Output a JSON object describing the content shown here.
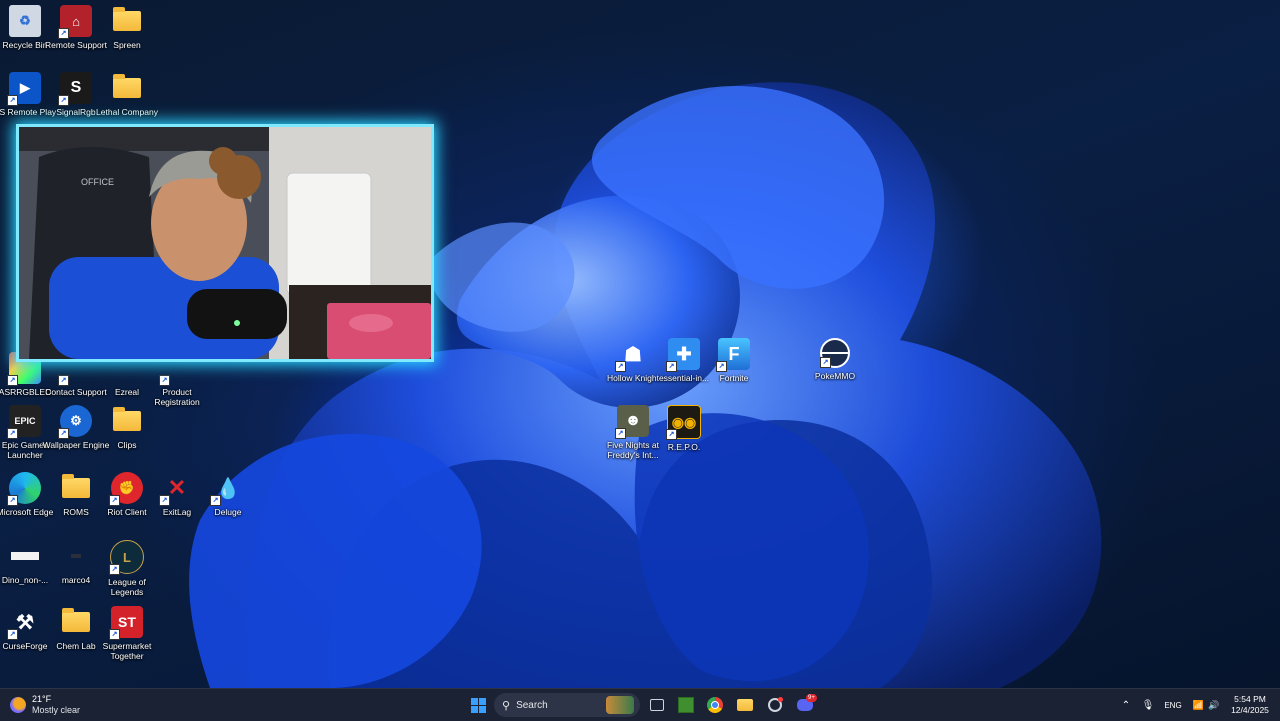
{
  "desktop_icons": [
    {
      "id": "recycle-bin",
      "label": "Recycle Bin"
    },
    {
      "id": "remote-support",
      "label": "Remote Support"
    },
    {
      "id": "spreen",
      "label": "Spreen"
    },
    {
      "id": "ps-remote-play",
      "label": "PS Remote Play"
    },
    {
      "id": "signalrgb",
      "label": "SignalRgb"
    },
    {
      "id": "lethal-company",
      "label": "Lethal Company"
    },
    {
      "id": "asrrgbled",
      "label": "ASRRGBLED"
    },
    {
      "id": "contact-support",
      "label": "Contact Support"
    },
    {
      "id": "ezreal",
      "label": "Ezreal"
    },
    {
      "id": "product-registration",
      "label": "Product Registration"
    },
    {
      "id": "epic-games-launcher",
      "label": "Epic Games Launcher"
    },
    {
      "id": "wallpaper-engine",
      "label": "Wallpaper Engine"
    },
    {
      "id": "clips",
      "label": "Clips"
    },
    {
      "id": "microsoft-edge",
      "label": "Microsoft Edge"
    },
    {
      "id": "roms",
      "label": "ROMS"
    },
    {
      "id": "riot-client",
      "label": "Riot Client"
    },
    {
      "id": "exitlag",
      "label": "ExitLag"
    },
    {
      "id": "deluge",
      "label": "Deluge"
    },
    {
      "id": "dino",
      "label": "Dino_non-..."
    },
    {
      "id": "marco4",
      "label": "marco4"
    },
    {
      "id": "league-of-legends",
      "label": "League of Legends"
    },
    {
      "id": "curseforge",
      "label": "CurseForge"
    },
    {
      "id": "chem-lab",
      "label": "Chem Lab"
    },
    {
      "id": "supermarket-together",
      "label": "Supermarket Together"
    },
    {
      "id": "hollow-knight",
      "label": "Hollow Knight"
    },
    {
      "id": "essential-in",
      "label": "essential-in..."
    },
    {
      "id": "fortnite",
      "label": "Fortnite"
    },
    {
      "id": "pokemmo",
      "label": "PokeMMO"
    },
    {
      "id": "five-nights",
      "label": "Five Nights at Freddy's Int..."
    },
    {
      "id": "repo",
      "label": "R.E.P.O."
    }
  ],
  "taskbar": {
    "weather_temp": "21°F",
    "weather_desc": "Mostly clear",
    "search_placeholder": "Search",
    "language": "ENG",
    "time": "5:54 PM",
    "date": "12/4/2025",
    "notification_badge": "9+"
  },
  "colors": {
    "webcam_border": "#7fe9ff",
    "taskbar_bg": "#1b2233",
    "accent": "#1f5cf0"
  }
}
